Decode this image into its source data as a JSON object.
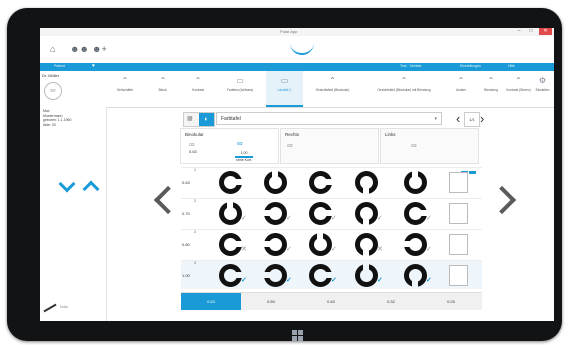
{
  "window": {
    "title": "Polar App",
    "controls": {
      "minimize": "–",
      "maximize": "□",
      "close": "✕"
    }
  },
  "header": {
    "icons": [
      "home-icon",
      "users-icon",
      "user-add-icon"
    ],
    "bluebar_left": "Patient",
    "bluebar_right": [
      "Test · Sehtest",
      "Einstellungen",
      "Hilfe"
    ]
  },
  "patient": {
    "header": "Dr. Müller",
    "avatar_text": "70°",
    "lines": [
      "Max",
      "Mustermann",
      "geboren: 1.1.1960",
      "Akte: 00"
    ],
    "footer": "Notiz"
  },
  "tabs": [
    {
      "label": "Sehschärfe",
      "icon": "eye-chart-icon"
    },
    {
      "label": "Binok.",
      "icon": "eye-chart-icon"
    },
    {
      "label": "Kontrast",
      "icon": "eye-chart-icon"
    },
    {
      "label": "Farbtest (Ishihara)",
      "icon": "monitor-icon"
    },
    {
      "label": "Landolt-C",
      "icon": "monitor-icon",
      "active": true
    },
    {
      "label": "Gesichtsfeld (Binokular)",
      "icon": "eye-chart-icon"
    },
    {
      "label": "Gesichtsfeld (Binokular) mit Blendung",
      "icon": "eye-chart-icon"
    },
    {
      "label": "Amsler",
      "icon": "eye-chart-icon"
    },
    {
      "label": "Blendung",
      "icon": "eye-chart-icon"
    },
    {
      "label": "Kontrast (Stereo)",
      "icon": "eye-chart-icon"
    },
    {
      "label": "Einstellen",
      "icon": "settings-icon"
    }
  ],
  "chart_selector": {
    "name": "Farbtafel",
    "page": "1/1"
  },
  "eyes": [
    {
      "label": "Binokular",
      "value": "0.63",
      "selected_value": "1.00",
      "selected_sub": "ohne Korr."
    },
    {
      "label": "Rechts"
    },
    {
      "label": "Links"
    }
  ],
  "rows": [
    {
      "num": "1",
      "acuity": "0.63",
      "rings": [
        {
          "gap": "right",
          "mark": ""
        },
        {
          "gap": "top",
          "mark": ""
        },
        {
          "gap": "right",
          "mark": ""
        },
        {
          "gap": "bottom",
          "mark": ""
        },
        {
          "gap": "top",
          "mark": ""
        }
      ]
    },
    {
      "num": "2",
      "acuity": "0.70",
      "rings": [
        {
          "gap": "top",
          "mark": "ok"
        },
        {
          "gap": "left",
          "mark": "ok"
        },
        {
          "gap": "right",
          "mark": "ok"
        },
        {
          "gap": "bottom",
          "mark": "ok"
        },
        {
          "gap": "right",
          "mark": "ok"
        }
      ]
    },
    {
      "num": "3",
      "acuity": "0.80",
      "rings": [
        {
          "gap": "right",
          "mark": "no"
        },
        {
          "gap": "left",
          "mark": "ok"
        },
        {
          "gap": "top",
          "mark": "ok"
        },
        {
          "gap": "bottom",
          "mark": "no"
        },
        {
          "gap": "left",
          "mark": "ok"
        }
      ]
    },
    {
      "num": "4",
      "acuity": "1.00",
      "rings": [
        {
          "gap": "right",
          "mark": "okb"
        },
        {
          "gap": "left",
          "mark": "okb"
        },
        {
          "gap": "right",
          "mark": "okb"
        },
        {
          "gap": "top",
          "mark": "okb"
        },
        {
          "gap": "bottom",
          "mark": "okb"
        }
      ]
    }
  ],
  "scores": [
    "0.63",
    "0.50",
    "0.40",
    "0.32",
    "0.25"
  ],
  "active_score_index": 0,
  "colors": {
    "accent": "#1a9ad6",
    "ring": "#111111"
  }
}
